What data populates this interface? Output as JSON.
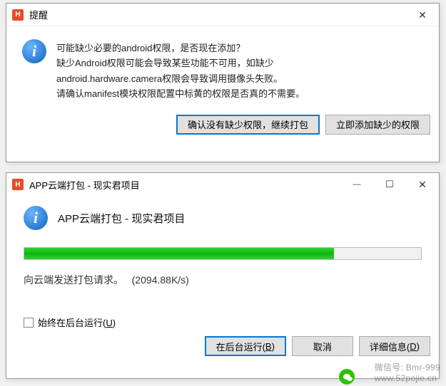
{
  "dialog1": {
    "title": "提醒",
    "lines": [
      "可能缺少必要的android权限，是否现在添加？",
      "缺少Android权限可能会导致某些功能不可用，如缺少",
      "android.hardware.camera权限会导致调用摄像头失败。",
      "请确认manifest模块权限配置中标黄的权限是否真的不需要。"
    ],
    "buttons": {
      "confirm": "确认没有缺少权限，继续打包",
      "addnow": "立即添加缺少的权限"
    }
  },
  "dialog2": {
    "title": "APP云端打包 - 现实君项目",
    "heading": "APP云端打包 - 现实君项目",
    "status_prefix": "向云端发送打包请求。",
    "speed": "(2094.88K/s)",
    "progress_percent": 78,
    "checkbox_label_pre": "始终在后台运行(",
    "checkbox_key": "U",
    "checkbox_label_post": ")",
    "buttons": {
      "background_pre": "在后台运行(",
      "background_key": "B",
      "background_post": ")",
      "cancel": "取消",
      "details_pre": "详细信息(",
      "details_key": "D",
      "details_post": ")"
    }
  },
  "watermark": {
    "wechat_label": "微信号",
    "wechat_id": "Bmr-999",
    "site": "www.52pojie.cn"
  }
}
